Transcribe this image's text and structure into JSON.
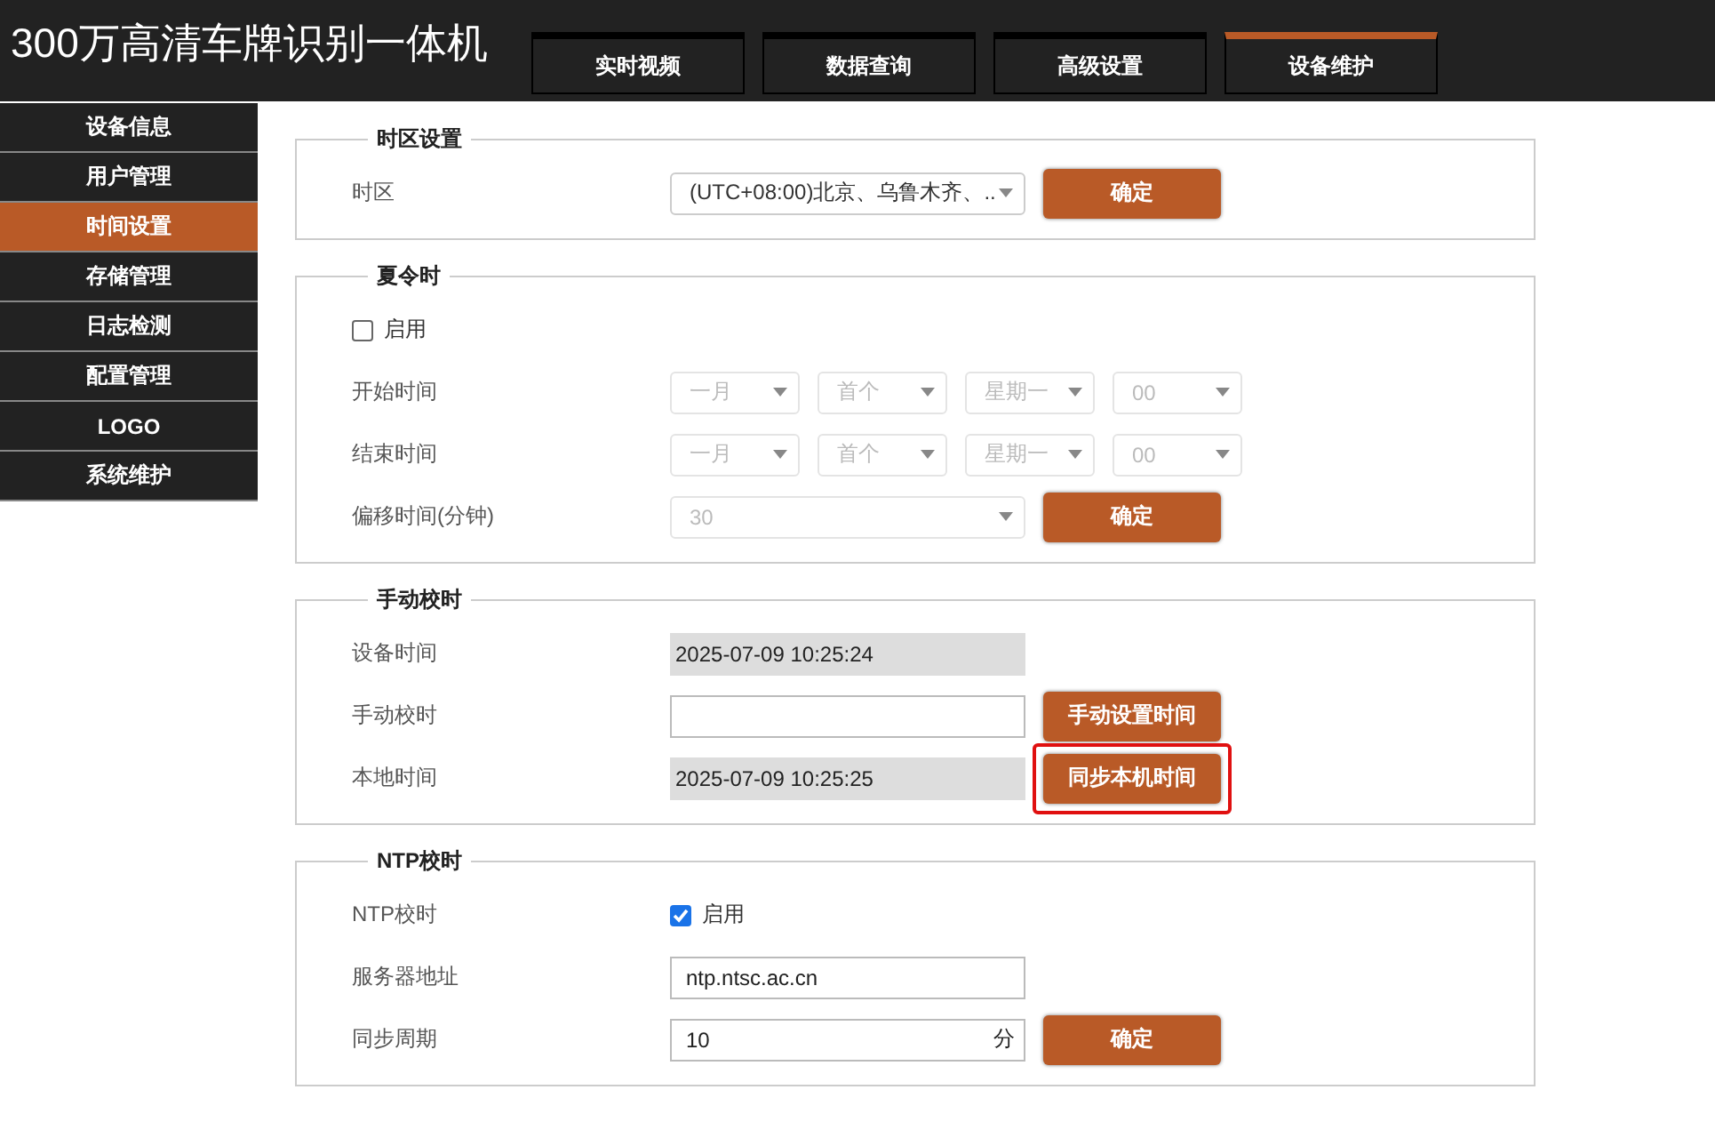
{
  "header": {
    "title": "300万高清车牌识别一体机"
  },
  "tabs": [
    {
      "label": "实时视频",
      "selected": false
    },
    {
      "label": "数据查询",
      "selected": false
    },
    {
      "label": "高级设置",
      "selected": false
    },
    {
      "label": "设备维护",
      "selected": true
    }
  ],
  "sidebar": {
    "items": [
      {
        "label": "设备信息",
        "selected": false
      },
      {
        "label": "用户管理",
        "selected": false
      },
      {
        "label": "时间设置",
        "selected": true
      },
      {
        "label": "存储管理",
        "selected": false
      },
      {
        "label": "日志检测",
        "selected": false
      },
      {
        "label": "配置管理",
        "selected": false
      },
      {
        "label": "LOGO",
        "selected": false
      },
      {
        "label": "系统维护",
        "selected": false
      }
    ]
  },
  "sections": [
    {
      "title": "时区设置",
      "rows": [
        {
          "kind": "select",
          "label": "时区",
          "value": "(UTC+08:00)北京、乌鲁木齐、..",
          "disabled": false,
          "button": {
            "label": "确定",
            "highlighted": false
          }
        }
      ]
    },
    {
      "title": "夏令时",
      "rows": [
        {
          "kind": "toggle",
          "checkbox_label": "启用",
          "checked": false
        },
        {
          "kind": "selects",
          "label": "开始时间",
          "values": [
            "一月",
            "首个",
            "星期一",
            "00"
          ],
          "disabled": true
        },
        {
          "kind": "selects",
          "label": "结束时间",
          "values": [
            "一月",
            "首个",
            "星期一",
            "00"
          ],
          "disabled": true
        },
        {
          "kind": "select",
          "label": "偏移时间(分钟)",
          "value": "30",
          "disabled": true,
          "button": {
            "label": "确定",
            "highlighted": false
          }
        }
      ]
    },
    {
      "title": "手动校时",
      "rows": [
        {
          "kind": "readonly",
          "label": "设备时间",
          "value": "2025-07-09 10:25:24"
        },
        {
          "kind": "input",
          "label": "手动校时",
          "button": {
            "label": "手动设置时间",
            "highlighted": false
          }
        },
        {
          "kind": "readonly",
          "label": "本地时间",
          "value": "2025-07-09 10:25:25",
          "button": {
            "label": "同步本机时间",
            "highlighted": true
          }
        }
      ]
    },
    {
      "title": "NTP校时",
      "rows": [
        {
          "kind": "checkbox",
          "label": "NTP校时",
          "checkbox_label": "启用",
          "checked": true
        },
        {
          "kind": "input",
          "label": "服务器地址",
          "value": "ntp.ntsc.ac.cn"
        },
        {
          "kind": "input_unit",
          "label": "同步周期",
          "value": "10",
          "unit": "分",
          "button": {
            "label": "确定",
            "highlighted": false
          }
        }
      ]
    }
  ]
}
